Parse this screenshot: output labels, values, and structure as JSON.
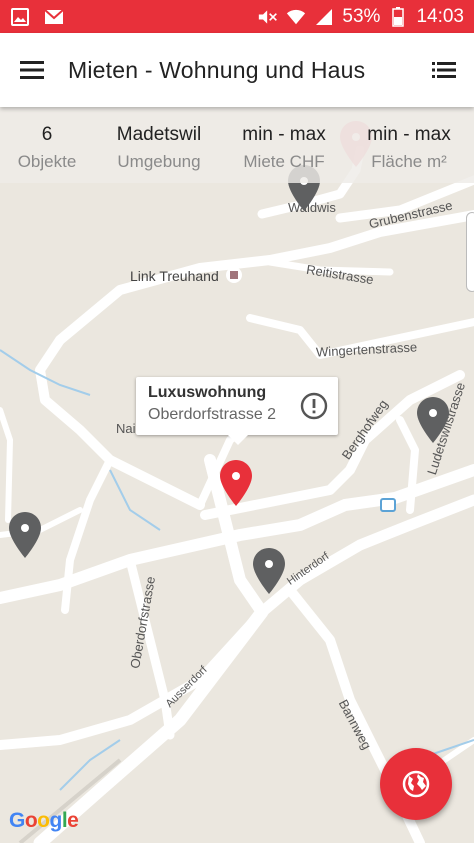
{
  "status_bar": {
    "battery": "53%",
    "time": "14:03",
    "icons": [
      "image-icon",
      "mail-icon",
      "mute-icon",
      "wifi-icon",
      "signal-icon",
      "battery-icon"
    ]
  },
  "app_bar": {
    "title": "Mieten - Wohnung und Haus",
    "menu_icon": "hamburger-icon",
    "list_icon": "list-icon"
  },
  "stats": [
    {
      "value": "6",
      "label": "Objekte"
    },
    {
      "value": "Madetswil",
      "label": "Umgebung"
    },
    {
      "value": "min - max",
      "label": "Miete CHF"
    },
    {
      "value": "min - max",
      "label": "Fläche m²"
    }
  ],
  "map": {
    "labels": {
      "waldwis": "Waldwis",
      "grubenstrasse": "Grubenstrasse",
      "link_treuhand": "Link Treuhand",
      "reitistrasse": "Reitistrasse",
      "wingertenstrasse": "Wingertenstrasse",
      "berghofweg": "Berghofweg",
      "ludetswil": "Ludetswilstrasse",
      "nai": "Nai",
      "oberdorfstrasse": "Oberdorfstrasse",
      "hinterdorf": "Hinterdorf",
      "ausserdorf": "Ausserdorf",
      "bannweg": "Bannweg"
    },
    "info_window": {
      "title": "Luxuswohnung",
      "address": "Oberdorfstrasse 2"
    },
    "colors": {
      "selected_pin": "#e8303a",
      "pin": "#5f6061",
      "faded_pin": "#ec9aa0"
    }
  },
  "google_logo": {
    "G": "G",
    "o1": "o",
    "o2": "o",
    "g": "g",
    "l": "l",
    "e": "e"
  },
  "fab_icon": "globe-icon"
}
